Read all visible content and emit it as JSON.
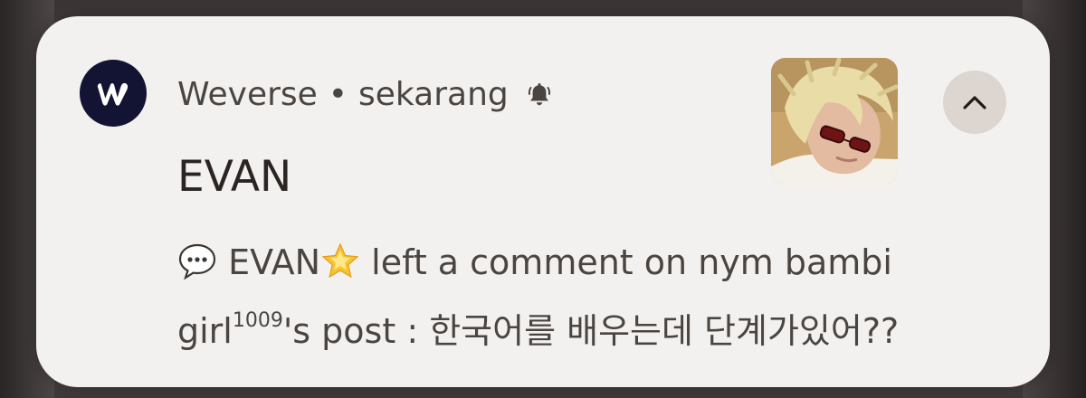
{
  "notification": {
    "app_name": "Weverse",
    "separator": "•",
    "time": "sekarang",
    "title": "EVAN",
    "message": {
      "speech_icon": "speech-bubble-icon",
      "author": "EVAN",
      "star_icon": "glowing-star-icon",
      "text_part1": " left a comment on nym bambi girl",
      "superscript": "1009",
      "text_part2": "'s post : 한국어를 배우는데 단계가있어??"
    },
    "icons": {
      "app": "weverse-logo-icon",
      "bell": "bell-icon",
      "expand": "chevron-up-icon"
    },
    "colors": {
      "card_bg": "#f3f1ef",
      "app_icon_bg": "#131333",
      "text_dark": "#2a2522",
      "text_muted": "#4b4541",
      "expand_button_bg": "#ddd5cf"
    }
  }
}
